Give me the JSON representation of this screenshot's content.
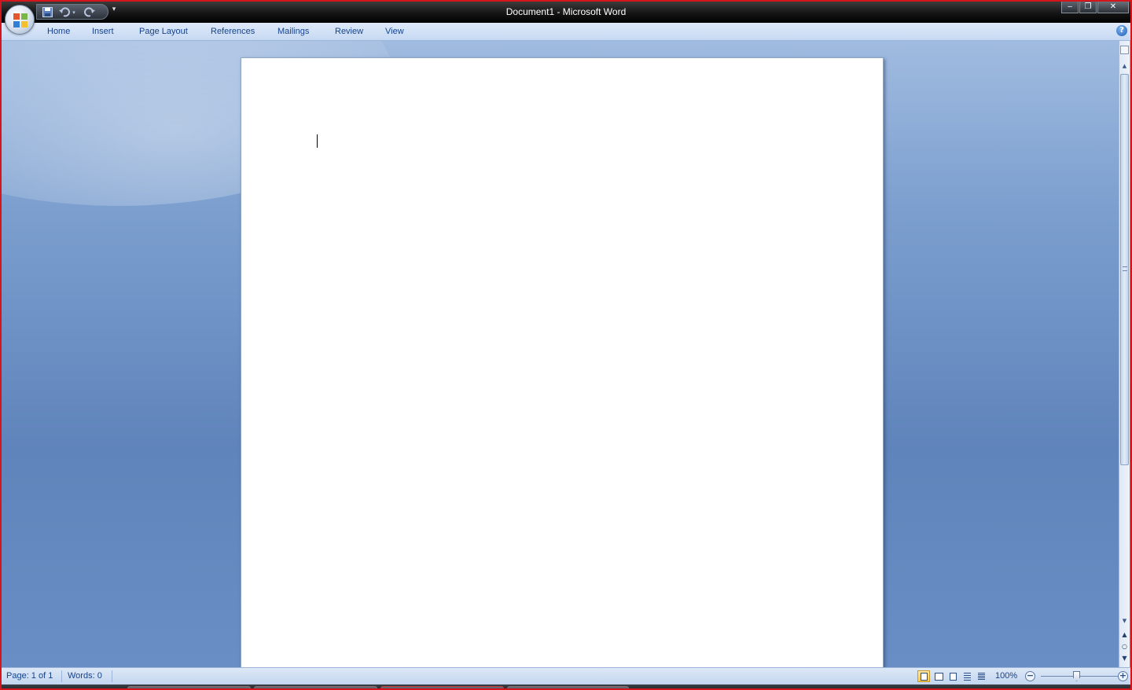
{
  "window": {
    "title": "Document1 - Microsoft Word"
  },
  "window_controls": {
    "minimize": "‒",
    "restore": "❐",
    "close": "✕"
  },
  "ribbon": {
    "tabs": [
      {
        "label": "Home"
      },
      {
        "label": "Insert"
      },
      {
        "label": "Page Layout"
      },
      {
        "label": "References"
      },
      {
        "label": "Mailings"
      },
      {
        "label": "Review"
      },
      {
        "label": "View"
      }
    ],
    "help_glyph": "?"
  },
  "quick_access": {
    "icons": [
      "save-icon",
      "undo-icon",
      "redo-icon"
    ],
    "customize_glyph": "▾"
  },
  "document": {
    "content": ""
  },
  "scrollbar": {
    "up_glyph": "▲",
    "down_glyph": "▼",
    "prev_glyph": "▲",
    "browse_glyph": "○",
    "next_glyph": "▼"
  },
  "status": {
    "page": "Page: 1 of 1",
    "words": "Words: 0",
    "zoom": "100%",
    "zoom_out": "−",
    "zoom_in": "+"
  },
  "colors": {
    "title_bar": "#000000",
    "tab_text": "#15428b",
    "frame_border": "#d4161c",
    "workspace": "#6b8fc4"
  }
}
